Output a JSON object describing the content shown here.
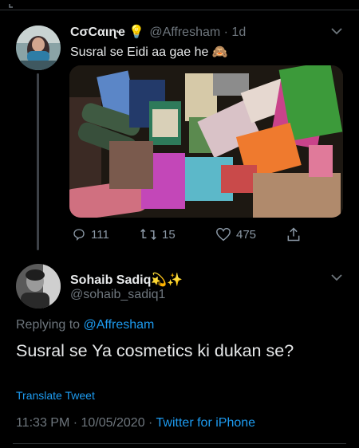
{
  "tweet": {
    "author_name": "CσCαιɳҽ 💡",
    "handle_date": "@Affresham · 1d",
    "text": "Susral se Eidi aa gae he 🙈",
    "actions": {
      "replies": "111",
      "retweets": "15",
      "likes": "475"
    },
    "icons": [
      "reply-icon",
      "retweet-icon",
      "like-icon",
      "share-icon",
      "chevron-down-icon"
    ]
  },
  "reply": {
    "author_name": "Sohaib Sadiq💫✨",
    "handle": "@sohaib_sadiq1",
    "replying_prefix": "Replying to ",
    "replying_to": "@Affresham",
    "text": "Susral se Ya cosmetics ki dukan se?",
    "translate_label": "Translate Tweet",
    "timestamp": "11:33 PM · 10/05/2020 · ",
    "source": "Twitter for iPhone"
  },
  "colors": {
    "background": "#000000",
    "link_blue": "#1d9bf0",
    "secondary_text": "#6e767d",
    "divider": "#2f3336"
  }
}
